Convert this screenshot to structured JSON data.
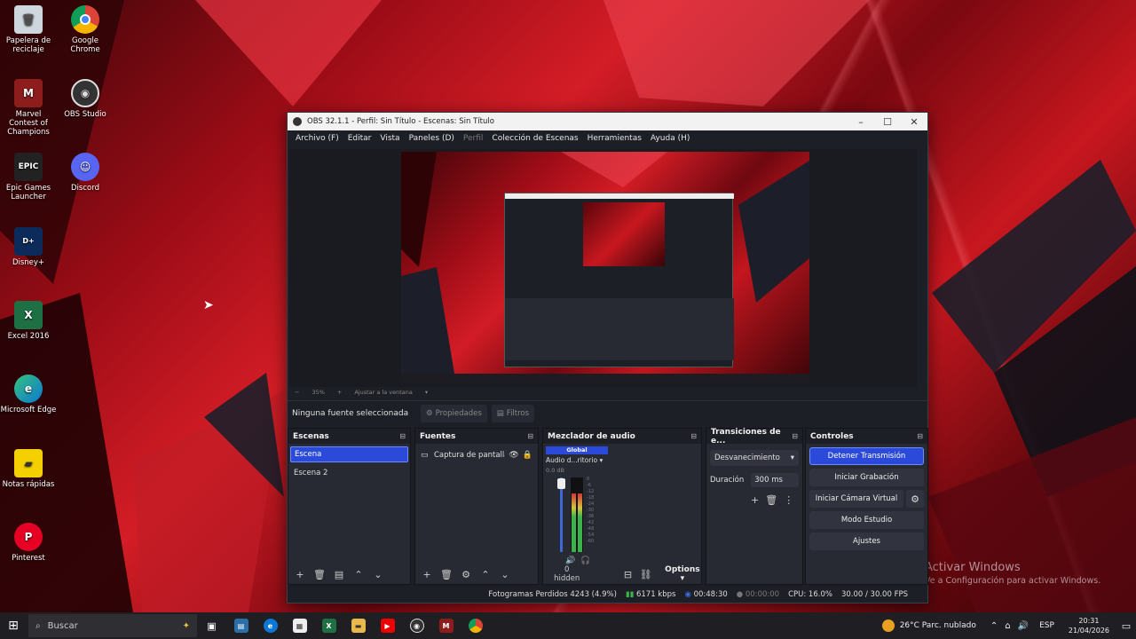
{
  "desktop": {
    "icons": [
      {
        "label": "Papelera de reciclaje",
        "icon": "recycle-bin-icon"
      },
      {
        "label": "Google Chrome",
        "icon": "chrome-icon"
      },
      {
        "label": "Marvel Contest of Champions",
        "icon": "marvel-icon"
      },
      {
        "label": "OBS Studio",
        "icon": "obs-icon"
      },
      {
        "label": "Epic Games Launcher",
        "icon": "epic-icon"
      },
      {
        "label": "Discord",
        "icon": "discord-icon"
      },
      {
        "label": "Disney+",
        "icon": "disney-icon"
      },
      {
        "label": "Excel 2016",
        "icon": "excel-icon"
      },
      {
        "label": "Microsoft Edge",
        "icon": "edge-icon"
      },
      {
        "label": "Notas rápidas",
        "icon": "sticky-notes-icon"
      },
      {
        "label": "Pinterest",
        "icon": "pinterest-icon"
      }
    ],
    "watermark_title": "Activar Windows",
    "watermark_sub": "Ve a Configuración para activar Windows."
  },
  "obs": {
    "title": "OBS 32.1.1 - Perfil: Sin Título - Escenas: Sin Título",
    "window_buttons": {
      "minimize": "–",
      "maximize": "☐",
      "close": "✕"
    },
    "menu": {
      "archivo": "Archivo (F)",
      "editar": "Editar",
      "vista": "Vista",
      "paneles": "Paneles (D)",
      "perfil": "Perfil",
      "coleccion": "Colección de Escenas",
      "herramientas": "Herramientas",
      "ayuda": "Ayuda (H)"
    },
    "zoom": {
      "minus": "−",
      "value": "35%",
      "plus": "+",
      "fit": "Ajustar a la ventana"
    },
    "source_toolbar": {
      "no_source": "Ninguna fuente seleccionada",
      "properties": "Propiedades",
      "filters": "Filtros"
    },
    "scenes": {
      "title": "Escenas",
      "items": [
        "Escena",
        "Escena 2"
      ]
    },
    "sources": {
      "title": "Fuentes",
      "items": [
        {
          "label": "Captura de pantalla"
        }
      ]
    },
    "mixer": {
      "title": "Mezclador de audio",
      "global_tag": "Global",
      "channel_name": "Audio del escritorio",
      "channel_display": "Audio d...ritorio",
      "db": "0.0 dB",
      "ticks": [
        "0",
        "-6",
        "-12",
        "-18",
        "-24",
        "-30",
        "-36",
        "-42",
        "-48",
        "-54",
        "-60"
      ],
      "level_fraction": 0.78,
      "hidden": "0 hidden",
      "options": "Options"
    },
    "transitions": {
      "title": "Transiciones de e...",
      "selected": "Desvanecimiento",
      "duration_label": "Duración",
      "duration_value": "300 ms"
    },
    "controls": {
      "title": "Controles",
      "stop_stream": "Detener Transmisión",
      "start_recording": "Iniciar Grabación",
      "start_virtual_cam": "Iniciar Cámara Virtual",
      "studio_mode": "Modo Estudio",
      "settings": "Ajustes"
    },
    "status": {
      "dropped": "Fotogramas Perdidos 4243 (4.9%)",
      "bitrate": "6171 kbps",
      "stream_time": "00:48:30",
      "rec_time": "00:00:00",
      "cpu": "CPU: 16.0%",
      "fps": "30.00 / 30.00 FPS"
    }
  },
  "taskbar": {
    "search_placeholder": "Buscar",
    "weather": "26°C  Parc. nublado",
    "language": "ESP",
    "time": "20:31",
    "date": "21/04/2026"
  }
}
